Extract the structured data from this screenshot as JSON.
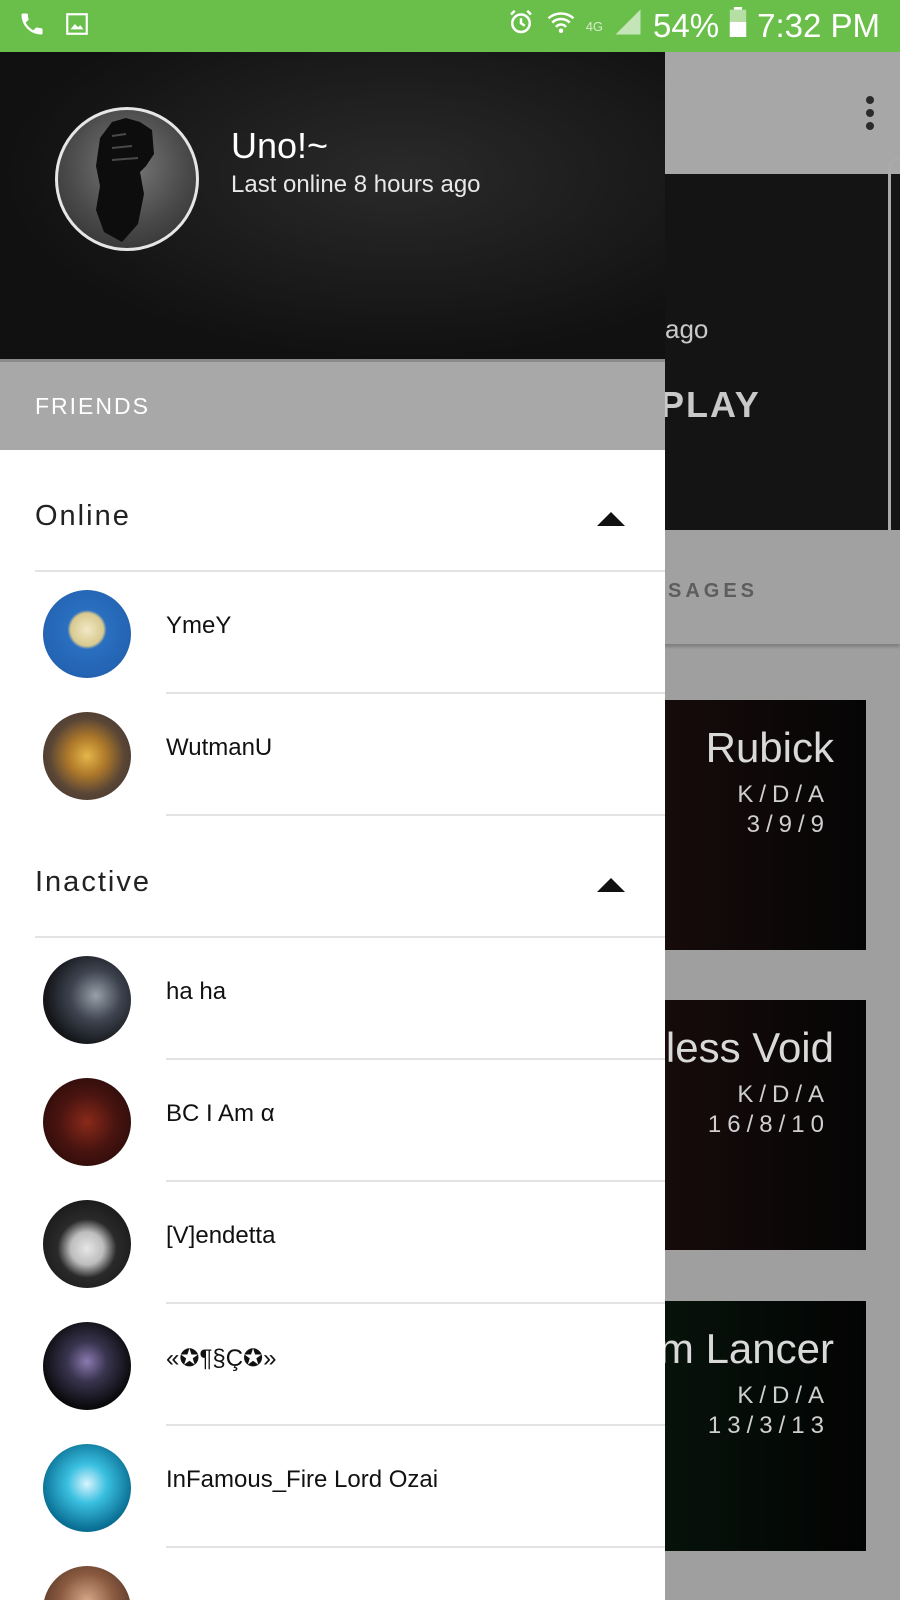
{
  "status_bar": {
    "battery": "54%",
    "time": "7:32 PM",
    "network": "4G",
    "icons": [
      "phone-icon",
      "image-icon",
      "alarm-icon",
      "wifi-icon",
      "signal-icon",
      "battery-icon"
    ]
  },
  "background_app": {
    "hero_ago": "ago",
    "hero_play": "PLAY",
    "tab_label": "SAGES",
    "cards": [
      {
        "title": "Rubick",
        "kda_label": "K/D/A",
        "kda": "3/9/9"
      },
      {
        "title": "less Void",
        "kda_label": "K/D/A",
        "kda": "16/8/10"
      },
      {
        "title": "m Lancer",
        "kda_label": "K/D/A",
        "kda": "13/3/13"
      }
    ]
  },
  "drawer": {
    "profile": {
      "name": "Uno!~",
      "status": "Last online 8 hours ago"
    },
    "friends_header": "FRIENDS",
    "online": {
      "title": "Online",
      "friends": [
        "YmeY",
        "WutmanU"
      ]
    },
    "inactive": {
      "title": "Inactive",
      "friends": [
        "ha ha",
        "BC I Am α",
        "[V]endetta",
        "«✪¶§Ç✪»",
        "InFamous_Fire Lord Ozai",
        ""
      ]
    }
  },
  "colors": {
    "status_bar": "#6abf4b",
    "friends_header": "#a8a8a8",
    "scrim": "#9f9f9f"
  }
}
